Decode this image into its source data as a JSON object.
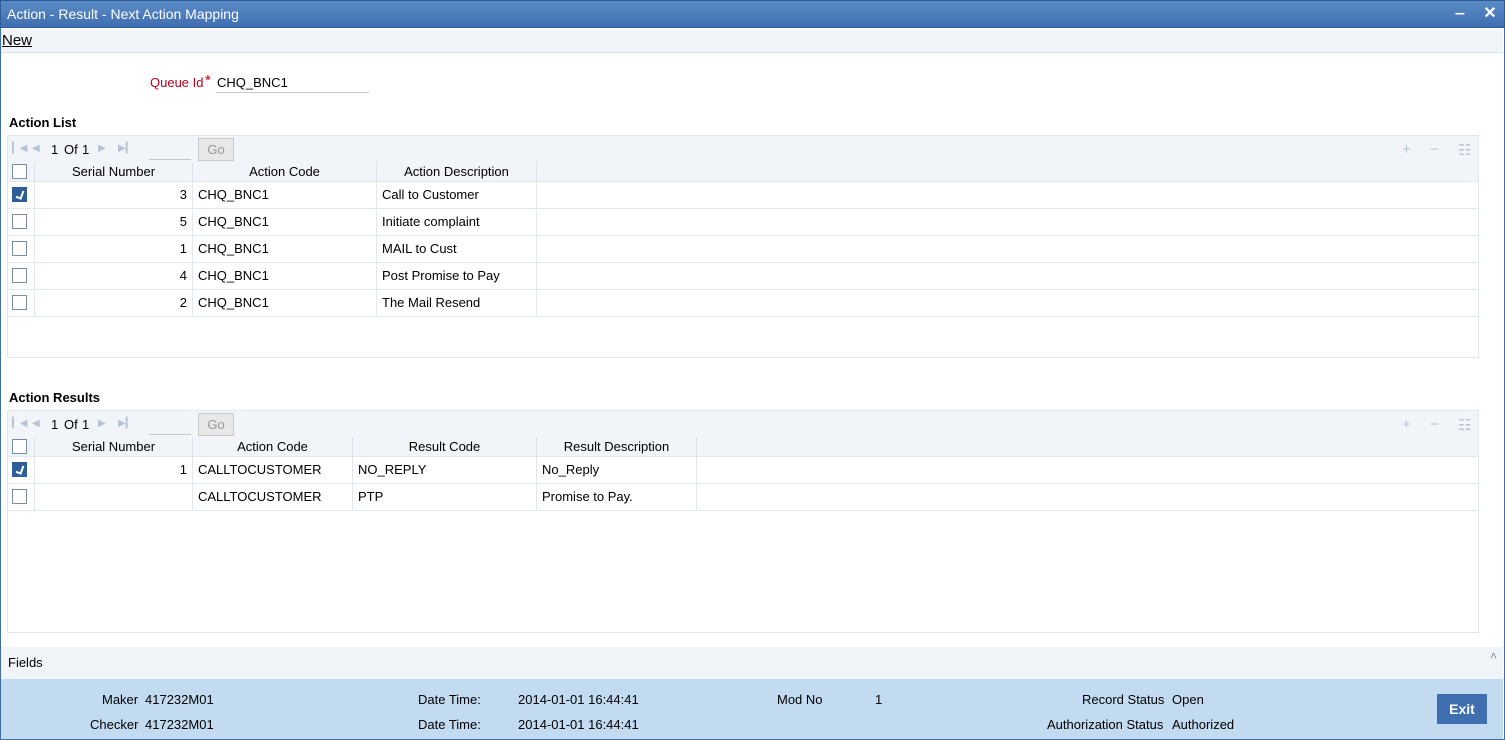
{
  "window": {
    "title": "Action - Result - Next Action Mapping",
    "minimize_glyph": "‒",
    "close_glyph": "✕"
  },
  "menu": {
    "new_label": "New"
  },
  "queue": {
    "label": "Queue Id",
    "required_mark": "*",
    "value": "CHQ_BNC1"
  },
  "action_list": {
    "title": "Action List",
    "page_current": "1",
    "page_of": "Of",
    "page_total": "1",
    "go_label": "Go",
    "columns": [
      "Serial Number",
      "Action Code",
      "Action Description"
    ],
    "rows": [
      {
        "serial": "3",
        "code": "CHQ_BNC1",
        "desc": "Call to Customer",
        "checked": true
      },
      {
        "serial": "5",
        "code": "CHQ_BNC1",
        "desc": "Initiate complaint",
        "checked": false
      },
      {
        "serial": "1",
        "code": "CHQ_BNC1",
        "desc": "MAIL to Cust",
        "checked": false
      },
      {
        "serial": "4",
        "code": "CHQ_BNC1",
        "desc": "Post Promise to Pay",
        "checked": false
      },
      {
        "serial": "2",
        "code": "CHQ_BNC1",
        "desc": "The Mail Resend",
        "checked": false
      }
    ]
  },
  "action_results": {
    "title": "Action Results",
    "page_current": "1",
    "page_of": "Of",
    "page_total": "1",
    "go_label": "Go",
    "columns": [
      "Serial Number",
      "Action Code",
      "Result Code",
      "Result Description"
    ],
    "rows": [
      {
        "serial": "1",
        "action_code": "CALLTOCUSTOMER",
        "result_code": "NO_REPLY",
        "result_desc": "No_Reply",
        "checked": true
      },
      {
        "serial": "",
        "action_code": "CALLTOCUSTOMER",
        "result_code": "PTP",
        "result_desc": "Promise to Pay.",
        "checked": false
      }
    ]
  },
  "fields": {
    "label": "Fields",
    "caret": "˄"
  },
  "toolbar_icons": {
    "add": "+",
    "remove": "−",
    "single_view": "☷"
  },
  "footer": {
    "maker_label": "Maker",
    "maker_value": "417232M01",
    "checker_label": "Checker",
    "checker_value": "417232M01",
    "datetime_label": "Date Time:",
    "maker_datetime": "2014-01-01 16:44:41",
    "checker_datetime": "2014-01-01 16:44:41",
    "modno_label": "Mod No",
    "modno_value": "1",
    "record_status_label": "Record Status",
    "record_status_value": "Open",
    "auth_status_label": "Authorization Status",
    "auth_status_value": "Authorized",
    "exit_label": "Exit"
  }
}
